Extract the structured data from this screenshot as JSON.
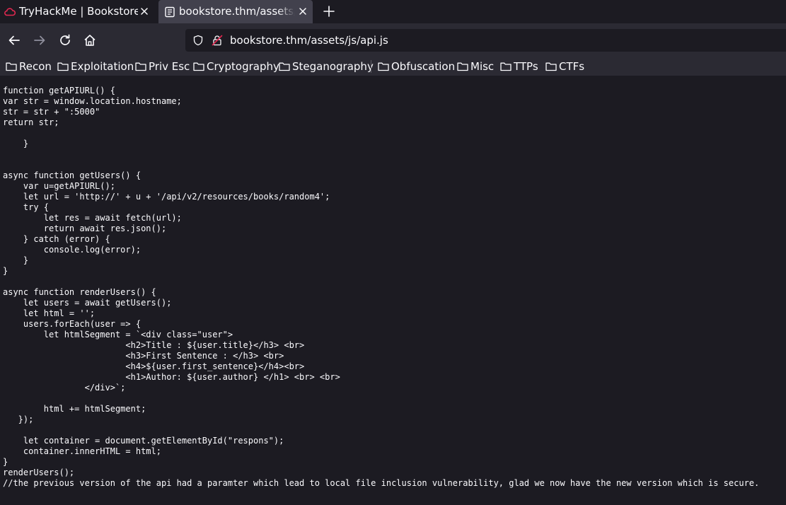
{
  "tabs": [
    {
      "title": "TryHackMe | Bookstore",
      "active": false,
      "icon": "tryhackme-cloud-icon"
    },
    {
      "title": "bookstore.thm/assets/js/api.js",
      "active": true,
      "icon": "document-icon"
    }
  ],
  "url": "bookstore.thm/assets/js/api.js",
  "bookmarks": [
    {
      "label": "Recon"
    },
    {
      "label": "Exploitation"
    },
    {
      "label": "Priv Esc"
    },
    {
      "label": "Cryptography"
    },
    {
      "label": "Steganography"
    },
    {
      "label": "Obfuscation"
    },
    {
      "label": "Misc"
    },
    {
      "label": "TTPs"
    },
    {
      "label": "CTFs"
    }
  ],
  "colors": {
    "accent": "#e22850",
    "tab_active": "#42414d",
    "toolbar": "#2b2a33",
    "page_background": "#1c1b22",
    "text": "#fbfbfe"
  },
  "source_code": "function getAPIURL() {\nvar str = window.location.hostname;\nstr = str + \":5000\"\nreturn str;\n\n    }\n\n\nasync function getUsers() {\n    var u=getAPIURL();\n    let url = 'http://' + u + '/api/v2/resources/books/random4';\n    try {\n        let res = await fetch(url);\n        return await res.json();\n    } catch (error) {\n        console.log(error);\n    }\n}\n\nasync function renderUsers() {\n    let users = await getUsers();\n    let html = '';\n    users.forEach(user => {\n        let htmlSegment = `<div class=\"user\">\n                        <h2>Title : ${user.title}</h3> <br>\n                        <h3>First Sentence : </h3> <br>\n                        <h4>${user.first_sentence}</h4><br>\n                        <h1>Author: ${user.author} </h1> <br> <br>\n                </div>`;\n\n        html += htmlSegment;\n   });\n\n    let container = document.getElementById(\"respons\");\n    container.innerHTML = html;\n}\nrenderUsers();\n//the previous version of the api had a paramter which lead to local file inclusion vulnerability, glad we now have the new version which is secure."
}
